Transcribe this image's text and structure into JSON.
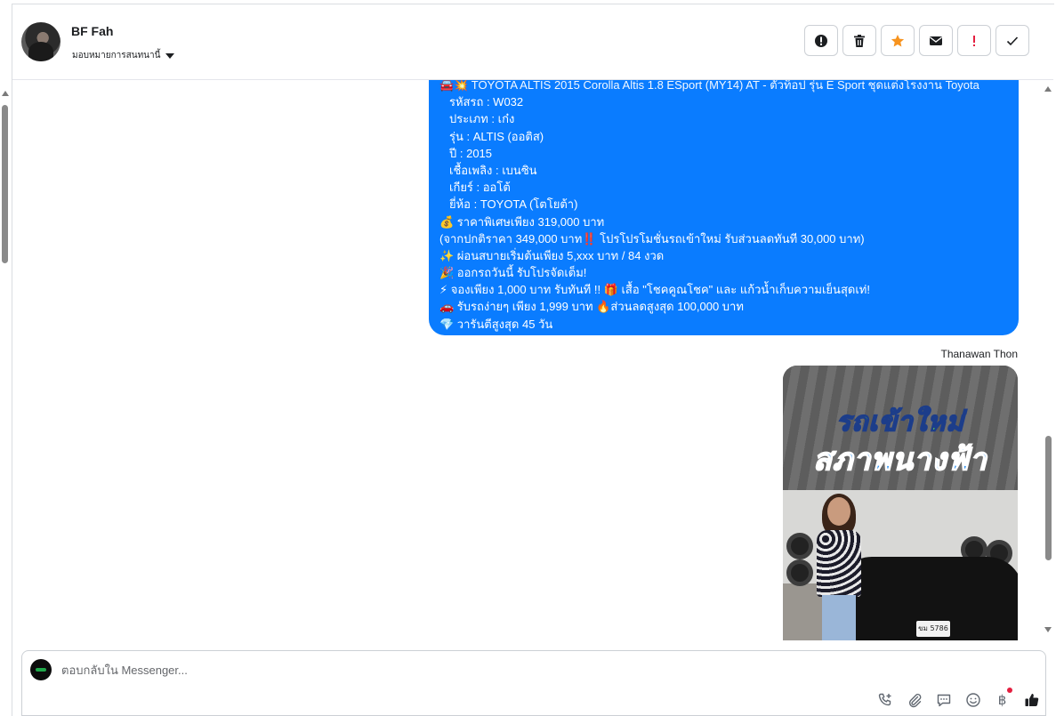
{
  "contact": {
    "name": "BF Fah",
    "assign_label": "มอบหมายการสนทนานี้"
  },
  "actions": [
    {
      "name": "report-icon",
      "color": "#1c1e21"
    },
    {
      "name": "delete-icon",
      "color": "#1c1e21"
    },
    {
      "name": "star-icon",
      "color": "#f7931e"
    },
    {
      "name": "mail-icon",
      "color": "#1c1e21"
    },
    {
      "name": "alert-icon",
      "color": "#e41e3f"
    },
    {
      "name": "check-icon",
      "color": "#1c1e21"
    }
  ],
  "message": {
    "bubble_color": "#0a7cff",
    "lines": [
      "🚘💥 TOYOTA ALTIS 2015 Corolla Altis 1.8 ESport (MY14) AT - ตัวท็อป รุ่น E Sport ชุดแต่งโรงงาน Toyota",
      "รหัสรถ : W032",
      "ประเภท : เก๋ง",
      "รุ่น : ALTIS (ออติส)",
      "ปี : 2015",
      "เชื้อเพลิง : เบนซิน",
      "เกียร์ : ออโต้",
      "ยี่ห้อ : TOYOTA (โตโยต้า)",
      "💰 ราคาพิเศษเพียง 319,000 บาท",
      "(จากปกติราคา 349,000 บาท‼️ โปรโปรโมชั่นรถเข้าใหม่ รับส่วนลดทันที 30,000 บาท)",
      "✨ ผ่อนสบายเริ่มต้นเพียง 5,xxx บาท / 84 งวด",
      "🎉 ออกรถวันนี้ รับโปรจัดเต็ม!",
      "⚡ จองเพียง 1,000 บาท รับทันที !! 🎁 เสื้อ \"โชคคูณโชค\" และ แก้วน้ำเก็บความเย็นสุดเท่!",
      "🚗 รับรถง่ายๆ เพียง 1,999 บาท 🔥ส่วนลดสูงสุด 100,000 บาท",
      "💎 วารันตีสูงสุด 45 วัน"
    ]
  },
  "image_message": {
    "sender": "Thanawan Thon",
    "headline_1": "รถเข้าใหม่",
    "headline_2": "สภาพนางฟ้า",
    "plate": "ขม 5786"
  },
  "composer": {
    "placeholder": "ตอบกลับใน Messenger...",
    "tools": [
      "phone-add-icon",
      "attach-icon",
      "saved-reply-icon",
      "emoji-icon",
      "baht-icon",
      "like-icon"
    ],
    "baht_symbol": "฿"
  }
}
